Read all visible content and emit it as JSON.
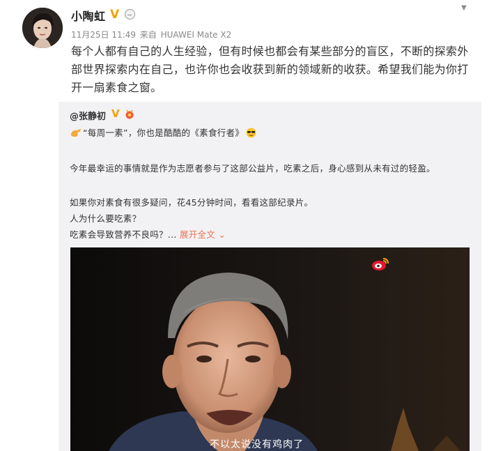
{
  "post": {
    "username": "小陶虹",
    "verified_mark": "V",
    "date": "11月25日 11:49",
    "source_prefix": "来自",
    "source": "HUAWEI Mate X2",
    "text": "每个人都有自己的人生经验，但有时候也都会有某些部分的盲区，不断的探索外部世界探索内在自己，也许你也会收获到新的领域新的收获。希望我们能为你打开一扇素食之窗。",
    "menu_icon": "chevron-down-icon"
  },
  "repost": {
    "username": "@张静初",
    "verified_mark": "V",
    "line1": "“每周一素”，你也是酷酷的《素食行者》",
    "line2": "今年最幸运的事情就是作为志愿者参与了这部公益片，吃素之后，身心感到从未有过的轻盈。",
    "line3": "如果你对素食有很多疑问，花45分钟时间，看看这部纪录片。",
    "line4": "人为什么要吃素？",
    "line5": "吃素会导致营养不良吗？...",
    "expand_label": "展开全文",
    "expand_icon": "⌄",
    "video": {
      "subtitle": "不以太说没有鸡肉了"
    }
  },
  "colors": {
    "verified": "#f6a000",
    "link": "#eb7350",
    "repost_bg": "#f2f2f5"
  }
}
